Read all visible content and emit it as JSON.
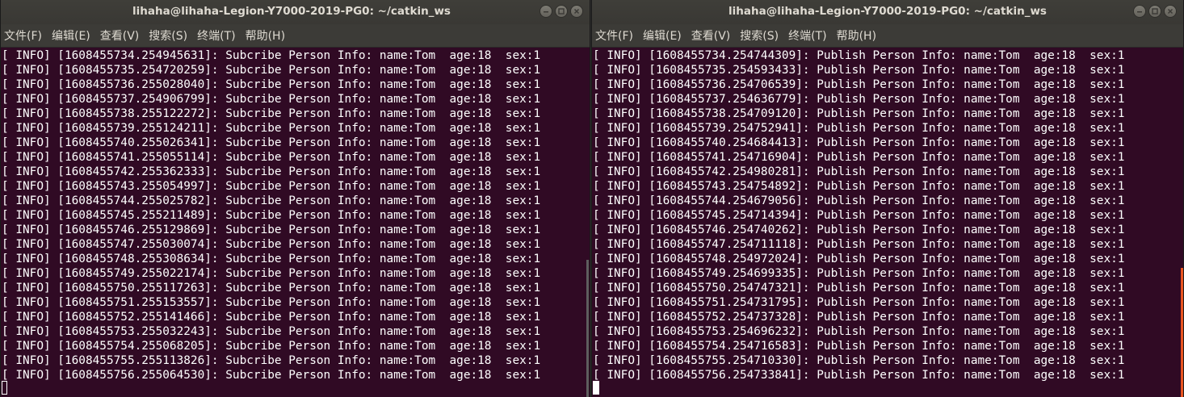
{
  "left": {
    "title": "lihaha@lihaha-Legion-Y7000-2019-PG0: ~/catkin_ws",
    "menu": [
      "文件(F)",
      "编辑(E)",
      "查看(V)",
      "搜索(S)",
      "终端(T)",
      "帮助(H)"
    ],
    "lines": [
      "[ INFO] [1608455734.254945631]: Subcribe Person Info: name:Tom  age:18  sex:1",
      "[ INFO] [1608455735.254720259]: Subcribe Person Info: name:Tom  age:18  sex:1",
      "[ INFO] [1608455736.255028040]: Subcribe Person Info: name:Tom  age:18  sex:1",
      "[ INFO] [1608455737.254906799]: Subcribe Person Info: name:Tom  age:18  sex:1",
      "[ INFO] [1608455738.255122272]: Subcribe Person Info: name:Tom  age:18  sex:1",
      "[ INFO] [1608455739.255124211]: Subcribe Person Info: name:Tom  age:18  sex:1",
      "[ INFO] [1608455740.255026341]: Subcribe Person Info: name:Tom  age:18  sex:1",
      "[ INFO] [1608455741.255055114]: Subcribe Person Info: name:Tom  age:18  sex:1",
      "[ INFO] [1608455742.255362333]: Subcribe Person Info: name:Tom  age:18  sex:1",
      "[ INFO] [1608455743.255054997]: Subcribe Person Info: name:Tom  age:18  sex:1",
      "[ INFO] [1608455744.255025782]: Subcribe Person Info: name:Tom  age:18  sex:1",
      "[ INFO] [1608455745.255211489]: Subcribe Person Info: name:Tom  age:18  sex:1",
      "[ INFO] [1608455746.255129869]: Subcribe Person Info: name:Tom  age:18  sex:1",
      "[ INFO] [1608455747.255030074]: Subcribe Person Info: name:Tom  age:18  sex:1",
      "[ INFO] [1608455748.255308634]: Subcribe Person Info: name:Tom  age:18  sex:1",
      "[ INFO] [1608455749.255022174]: Subcribe Person Info: name:Tom  age:18  sex:1",
      "[ INFO] [1608455750.255117263]: Subcribe Person Info: name:Tom  age:18  sex:1",
      "[ INFO] [1608455751.255153557]: Subcribe Person Info: name:Tom  age:18  sex:1",
      "[ INFO] [1608455752.255141466]: Subcribe Person Info: name:Tom  age:18  sex:1",
      "[ INFO] [1608455753.255032243]: Subcribe Person Info: name:Tom  age:18  sex:1",
      "[ INFO] [1608455754.255068205]: Subcribe Person Info: name:Tom  age:18  sex:1",
      "[ INFO] [1608455755.255113826]: Subcribe Person Info: name:Tom  age:18  sex:1",
      "[ INFO] [1608455756.255064530]: Subcribe Person Info: name:Tom  age:18  sex:1"
    ]
  },
  "right": {
    "title": "lihaha@lihaha-Legion-Y7000-2019-PG0: ~/catkin_ws",
    "menu": [
      "文件(F)",
      "编辑(E)",
      "查看(V)",
      "搜索(S)",
      "终端(T)",
      "帮助(H)"
    ],
    "lines": [
      "[ INFO] [1608455734.254744309]: Publish Person Info: name:Tom  age:18  sex:1",
      "[ INFO] [1608455735.254593433]: Publish Person Info: name:Tom  age:18  sex:1",
      "[ INFO] [1608455736.254706539]: Publish Person Info: name:Tom  age:18  sex:1",
      "[ INFO] [1608455737.254636779]: Publish Person Info: name:Tom  age:18  sex:1",
      "[ INFO] [1608455738.254709120]: Publish Person Info: name:Tom  age:18  sex:1",
      "[ INFO] [1608455739.254752941]: Publish Person Info: name:Tom  age:18  sex:1",
      "[ INFO] [1608455740.254684413]: Publish Person Info: name:Tom  age:18  sex:1",
      "[ INFO] [1608455741.254716904]: Publish Person Info: name:Tom  age:18  sex:1",
      "[ INFO] [1608455742.254980281]: Publish Person Info: name:Tom  age:18  sex:1",
      "[ INFO] [1608455743.254754892]: Publish Person Info: name:Tom  age:18  sex:1",
      "[ INFO] [1608455744.254679056]: Publish Person Info: name:Tom  age:18  sex:1",
      "[ INFO] [1608455745.254714394]: Publish Person Info: name:Tom  age:18  sex:1",
      "[ INFO] [1608455746.254740262]: Publish Person Info: name:Tom  age:18  sex:1",
      "[ INFO] [1608455747.254711118]: Publish Person Info: name:Tom  age:18  sex:1",
      "[ INFO] [1608455748.254972024]: Publish Person Info: name:Tom  age:18  sex:1",
      "[ INFO] [1608455749.254699335]: Publish Person Info: name:Tom  age:18  sex:1",
      "[ INFO] [1608455750.254747321]: Publish Person Info: name:Tom  age:18  sex:1",
      "[ INFO] [1608455751.254731795]: Publish Person Info: name:Tom  age:18  sex:1",
      "[ INFO] [1608455752.254737328]: Publish Person Info: name:Tom  age:18  sex:1",
      "[ INFO] [1608455753.254696232]: Publish Person Info: name:Tom  age:18  sex:1",
      "[ INFO] [1608455754.254716583]: Publish Person Info: name:Tom  age:18  sex:1",
      "[ INFO] [1608455755.254710330]: Publish Person Info: name:Tom  age:18  sex:1",
      "[ INFO] [1608455756.254733841]: Publish Person Info: name:Tom  age:18  sex:1"
    ]
  },
  "colors": {
    "terminal_bg": "#300a24",
    "titlebar_bg": "#3c3b37",
    "text": "#ffffff",
    "scroll_accent": "#e95420"
  },
  "icons": [
    "minimize-icon",
    "maximize-icon",
    "close-icon"
  ]
}
